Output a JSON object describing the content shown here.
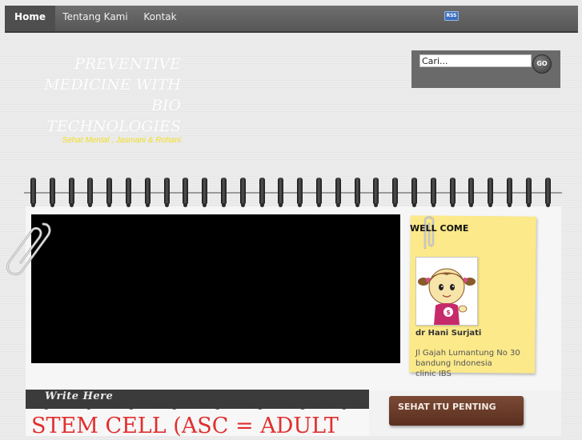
{
  "nav": {
    "items": [
      {
        "label": "Home",
        "active": true
      },
      {
        "label": "Tentang Kami",
        "active": false
      },
      {
        "label": "Kontak",
        "active": false
      }
    ],
    "rss_label": "RSS"
  },
  "site": {
    "title": "PREVENTIVE MEDICINE WITH BIO TECHNOLOGIES",
    "tagline": "Sehat Mental , Jasmani & Rohani"
  },
  "search": {
    "value": "Cari...",
    "button_label": "GO"
  },
  "welcome": {
    "title": "WELL COME",
    "name": "dr Hani Surjati",
    "address": [
      "Jl Gajah Lumantung No 30",
      "bandung Indonesia",
      "clinic IBS"
    ]
  },
  "write_here": "Write Here",
  "post": {
    "title": "STEM CELL (ASC = ADULT"
  },
  "widget": {
    "title": "SEHAT ITU PENTING"
  },
  "colors": {
    "nav_bg": "#575757",
    "tagline": "#f2df20",
    "sticky_note": "#fbe98a",
    "post_title": "#e0302f",
    "widget_header": "#5a2f1f"
  },
  "icons": {
    "rss": "rss-icon",
    "paperclip": "paperclip-icon",
    "go": "go-button"
  }
}
